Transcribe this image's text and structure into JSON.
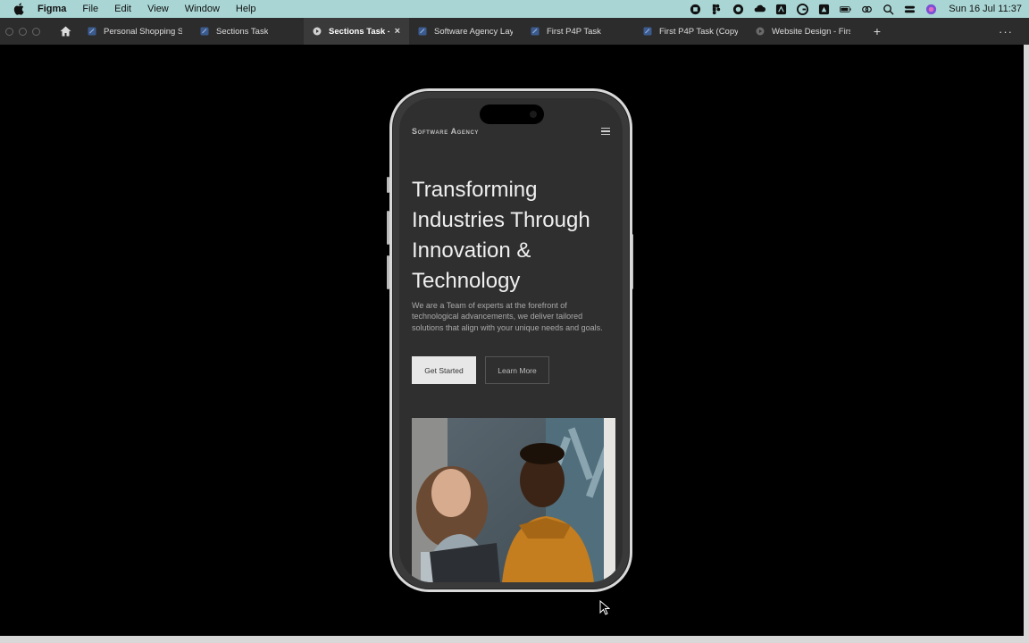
{
  "menubar": {
    "app_name": "Figma",
    "items": [
      "File",
      "Edit",
      "View",
      "Window",
      "Help"
    ],
    "clock": "Sun 16 Jul  11:37"
  },
  "tabs": [
    {
      "label": "Personal Shopping S",
      "active": false
    },
    {
      "label": "Sections Task",
      "active": false
    },
    {
      "label": "Sections Task - Se",
      "active": true
    },
    {
      "label": "Software Agency Lay",
      "active": false
    },
    {
      "label": "First P4P Task",
      "active": false
    },
    {
      "label": "First P4P Task (Copy",
      "active": false
    },
    {
      "label": "Website Design - Firs",
      "active": false
    }
  ],
  "tabbar": {
    "new_tab": "+",
    "more": "···",
    "close": "×"
  },
  "prototype": {
    "brand": "Software Agency",
    "hero_title": "Transforming Industries Through Innovation & Technology",
    "hero_description": "We are a Team of experts at the forefront of technological advancements, we deliver tailored solutions that align with your unique needs and goals.",
    "primary_button": "Get Started",
    "secondary_button": "Learn More"
  },
  "colors": {
    "menubar_bg": "#a9d6d4",
    "tabbar_bg": "#2c2c2c",
    "canvas_bg": "#000000",
    "phone_screen_bg": "#2f2f2f",
    "primary_button_bg": "#e7e7e7"
  }
}
